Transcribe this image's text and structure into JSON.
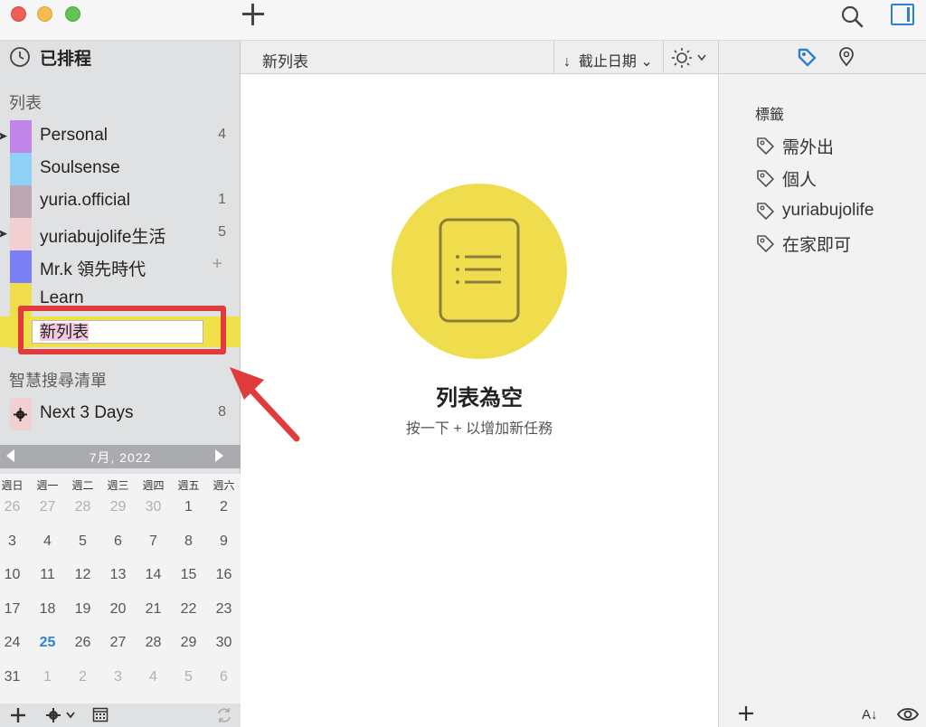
{
  "toolbar": {
    "new_label": "+"
  },
  "sidebar": {
    "scheduled_label": "已排程",
    "lists_title": "列表",
    "lists": [
      {
        "label": "Personal",
        "count": "4",
        "color": "#c185ea",
        "has_children": true
      },
      {
        "label": "Soulsense",
        "count": "",
        "color": "#8ed0f6",
        "has_children": false
      },
      {
        "label": "yuria.official",
        "count": "1",
        "color": "#bba6b2",
        "has_children": false
      },
      {
        "label": "yuriabujolife生活",
        "count": "5",
        "color": "#f2cfd0",
        "has_children": true
      },
      {
        "label": "Mr.k 領先時代",
        "count": "+",
        "color": "#7b7ff5",
        "has_children": false
      },
      {
        "label": "Learn",
        "count": "",
        "color": "#efdd4d",
        "has_children": false
      }
    ],
    "editing_list": {
      "value": "新列表"
    },
    "smart_title": "智慧搜尋清單",
    "smart_lists": [
      {
        "label": "Next 3 Days",
        "count": "8"
      }
    ]
  },
  "calendar": {
    "month_label": "7月, 2022",
    "weekdays": [
      "週日",
      "週一",
      "週二",
      "週三",
      "週四",
      "週五",
      "週六"
    ],
    "weeks": [
      [
        "26",
        "27",
        "28",
        "29",
        "30",
        "1",
        "2"
      ],
      [
        "3",
        "4",
        "5",
        "6",
        "7",
        "8",
        "9"
      ],
      [
        "10",
        "11",
        "12",
        "13",
        "14",
        "15",
        "16"
      ],
      [
        "17",
        "18",
        "19",
        "20",
        "21",
        "22",
        "23"
      ],
      [
        "24",
        "25",
        "26",
        "27",
        "28",
        "29",
        "30"
      ],
      [
        "31",
        "1",
        "2",
        "3",
        "4",
        "5",
        "6"
      ]
    ],
    "today": "25"
  },
  "main": {
    "title": "新列表",
    "sort_label": "截止日期",
    "empty_title": "列表為空",
    "empty_subtitle": "按一下 + 以增加新任務"
  },
  "inspector": {
    "tags_title": "標籤",
    "tags": [
      "需外出",
      "個人",
      "yuriabujolife",
      "在家即可"
    ],
    "sort_label": "A↓"
  },
  "colors": {
    "accent": "#2f7fd1",
    "highlight": "#e03c3c",
    "empty_circle": "#efdd4d"
  }
}
